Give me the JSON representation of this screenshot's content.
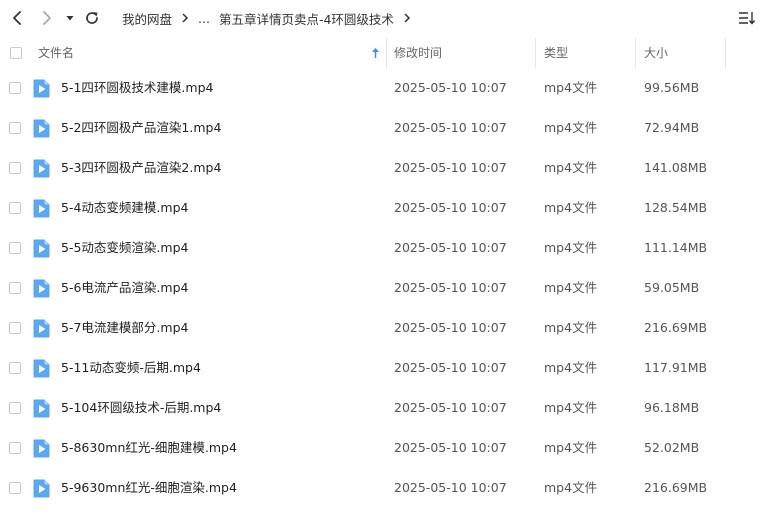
{
  "toolbar": {
    "back_icon": "chevron-left-icon",
    "forward_icon": "chevron-right-icon",
    "history_icon": "caret-down-icon",
    "refresh_icon": "refresh-icon",
    "sort_icon": "sort-list-icon"
  },
  "breadcrumb": {
    "items": [
      "我的网盘",
      "...",
      "第五章详情页卖点-4环圆级技术"
    ]
  },
  "header": {
    "name": "文件名",
    "time": "修改时间",
    "type": "类型",
    "size": "大小",
    "sort_indicator": "sort-ascending-arrow-icon"
  },
  "colors": {
    "accent": "#3a8ee6",
    "file_icon": "#5aa8ef",
    "text": "#333333",
    "muted": "#666666"
  },
  "files": [
    {
      "name": "5-1四环圆极技术建模.mp4",
      "time": "2025-05-10 10:07",
      "type": "mp4文件",
      "size": "99.56MB"
    },
    {
      "name": "5-2四环圆极产品渲染1.mp4",
      "time": "2025-05-10 10:07",
      "type": "mp4文件",
      "size": "72.94MB"
    },
    {
      "name": "5-3四环圆极产品渲染2.mp4",
      "time": "2025-05-10 10:07",
      "type": "mp4文件",
      "size": "141.08MB"
    },
    {
      "name": "5-4动态变频建模.mp4",
      "time": "2025-05-10 10:07",
      "type": "mp4文件",
      "size": "128.54MB"
    },
    {
      "name": "5-5动态变频渲染.mp4",
      "time": "2025-05-10 10:07",
      "type": "mp4文件",
      "size": "111.14MB"
    },
    {
      "name": "5-6电流产品渲染.mp4",
      "time": "2025-05-10 10:07",
      "type": "mp4文件",
      "size": "59.05MB"
    },
    {
      "name": "5-7电流建模部分.mp4",
      "time": "2025-05-10 10:07",
      "type": "mp4文件",
      "size": "216.69MB"
    },
    {
      "name": "5-11动态变频-后期.mp4",
      "time": "2025-05-10 10:07",
      "type": "mp4文件",
      "size": "117.91MB"
    },
    {
      "name": "5-104环圆级技术-后期.mp4",
      "time": "2025-05-10 10:07",
      "type": "mp4文件",
      "size": "96.18MB"
    },
    {
      "name": "5-8630mn红光-细胞建模.mp4",
      "time": "2025-05-10 10:07",
      "type": "mp4文件",
      "size": "52.02MB"
    },
    {
      "name": "5-9630mn红光-细胞渲染.mp4",
      "time": "2025-05-10 10:07",
      "type": "mp4文件",
      "size": "216.69MB"
    }
  ]
}
